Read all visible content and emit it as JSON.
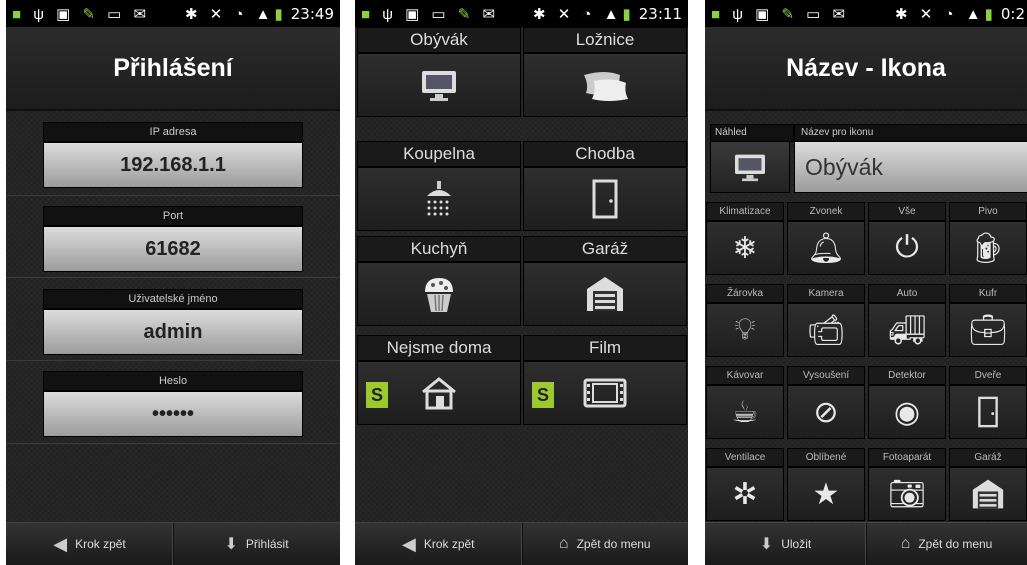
{
  "screen1": {
    "status": {
      "time": "23:49"
    },
    "title": "Přihlášení",
    "fields": [
      {
        "label": "IP adresa",
        "value": "192.168.1.1"
      },
      {
        "label": "Port",
        "value": "61682"
      },
      {
        "label": "Uživatelské jméno",
        "value": "admin"
      },
      {
        "label": "Heslo",
        "value": "••••••"
      }
    ],
    "back_label": "Krok zpět",
    "login_label": "Přihlásit"
  },
  "screen2": {
    "status": {
      "time": "23:11"
    },
    "rooms": [
      {
        "label": "Obývák",
        "icon": "tv-icon"
      },
      {
        "label": "Ložnice",
        "icon": "pillow-icon"
      },
      {
        "label": "Koupelna",
        "icon": "shower-icon"
      },
      {
        "label": "Chodba",
        "icon": "door-icon"
      },
      {
        "label": "Kuchyň",
        "icon": "muffin-icon"
      },
      {
        "label": "Garáž",
        "icon": "garage-icon"
      },
      {
        "label": "Nejsme doma",
        "icon": "house-icon",
        "badge": "S"
      },
      {
        "label": "Film",
        "icon": "film-icon",
        "badge": "S"
      }
    ],
    "back_label": "Krok zpět",
    "menu_label": "Zpět do menu"
  },
  "screen3": {
    "status": {
      "time": "0:2"
    },
    "title": "Název - Ikona",
    "preview_label": "Náhled",
    "name_label": "Název pro ikonu",
    "name_value": "Obývák",
    "icons": [
      {
        "label": "Klimatizace",
        "icon": "snowflake-icon"
      },
      {
        "label": "Zvonek",
        "icon": "bell-icon"
      },
      {
        "label": "Vše",
        "icon": "power-icon"
      },
      {
        "label": "Pivo",
        "icon": "beer-icon"
      },
      {
        "label": "Žárovka",
        "icon": "bulb-icon"
      },
      {
        "label": "Kamera",
        "icon": "camera-icon"
      },
      {
        "label": "Auto",
        "icon": "car-icon"
      },
      {
        "label": "Kufr",
        "icon": "case-icon"
      },
      {
        "label": "Kávovar",
        "icon": "coffee-icon"
      },
      {
        "label": "Vysoušení",
        "icon": "dryer-icon"
      },
      {
        "label": "Detektor",
        "icon": "detector-icon"
      },
      {
        "label": "Dveře",
        "icon": "door-icon"
      },
      {
        "label": "Ventilace",
        "icon": "fan-icon"
      },
      {
        "label": "Oblíbené",
        "icon": "star-icon"
      },
      {
        "label": "Fotoaparát",
        "icon": "photo-icon"
      },
      {
        "label": "Garáž",
        "icon": "garage-icon"
      }
    ],
    "save_label": "Uložit",
    "menu_label": "Zpět do menu"
  },
  "colors": {
    "accent_green": "#9cc92d",
    "statusbar": "#000000"
  }
}
